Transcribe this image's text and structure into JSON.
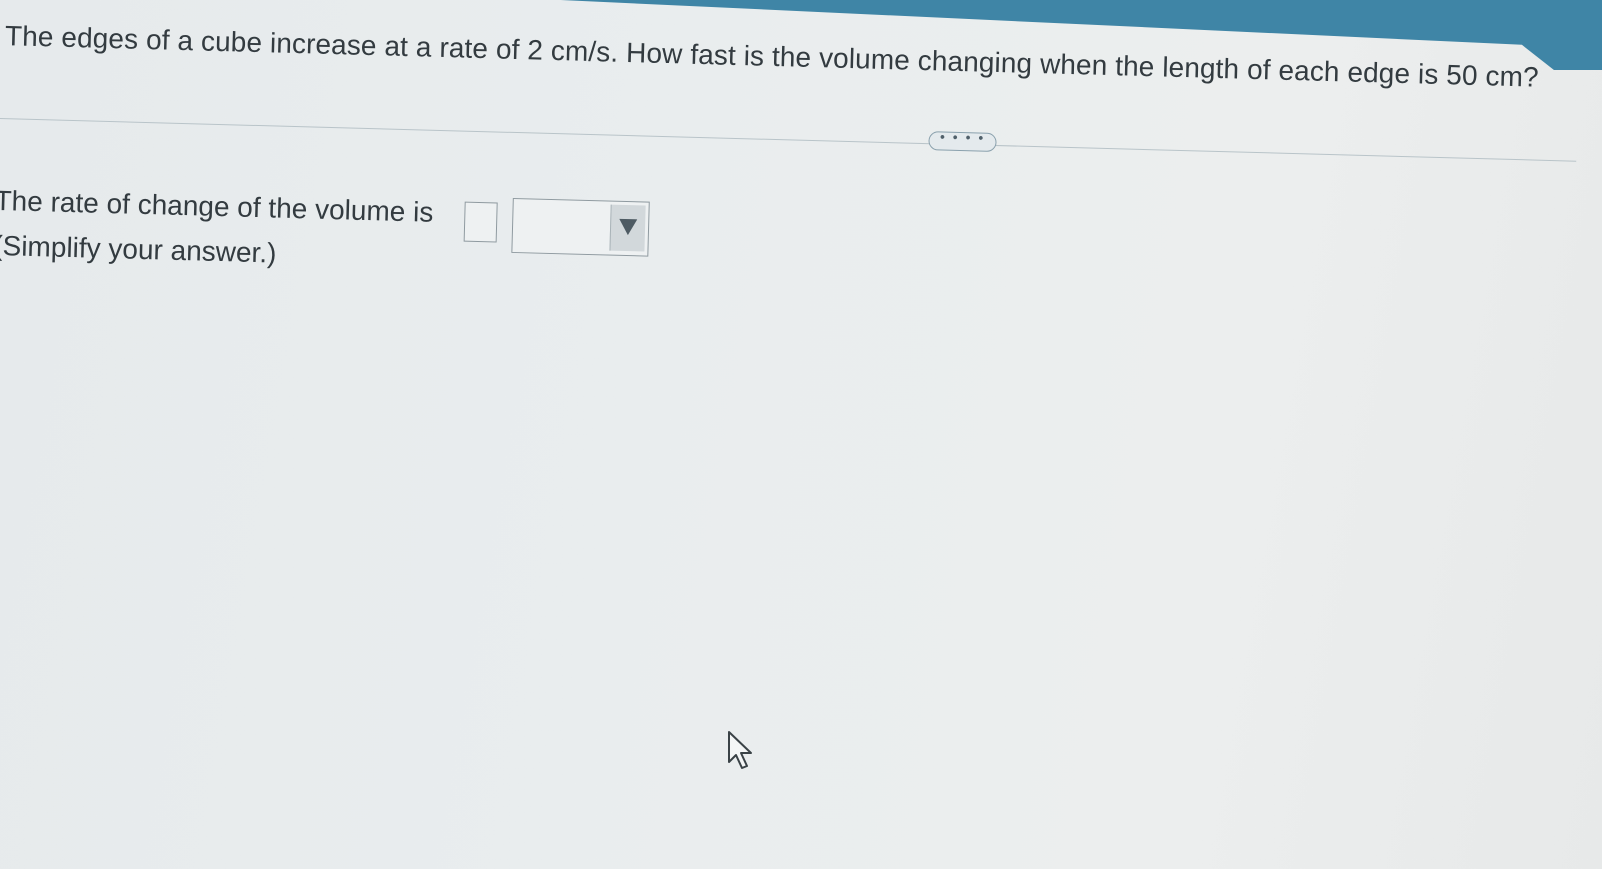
{
  "question": {
    "text": "The edges of a cube increase at a rate of 2 cm/s. How fast is the volume changing when the length of each edge is 50 cm?"
  },
  "more_button": {
    "label": "• • • •",
    "icon": "ellipsis-icon"
  },
  "answer": {
    "prompt": "The rate of change of the volume is",
    "value": "",
    "unit_selected": "",
    "hint": "(Simplify your answer.)"
  },
  "icons": {
    "dropdown": "triangle-down-icon",
    "cursor": "mouse-pointer-icon"
  },
  "colors": {
    "banner": "#3f85a6",
    "text": "#333b40",
    "background": "#e9edee"
  }
}
